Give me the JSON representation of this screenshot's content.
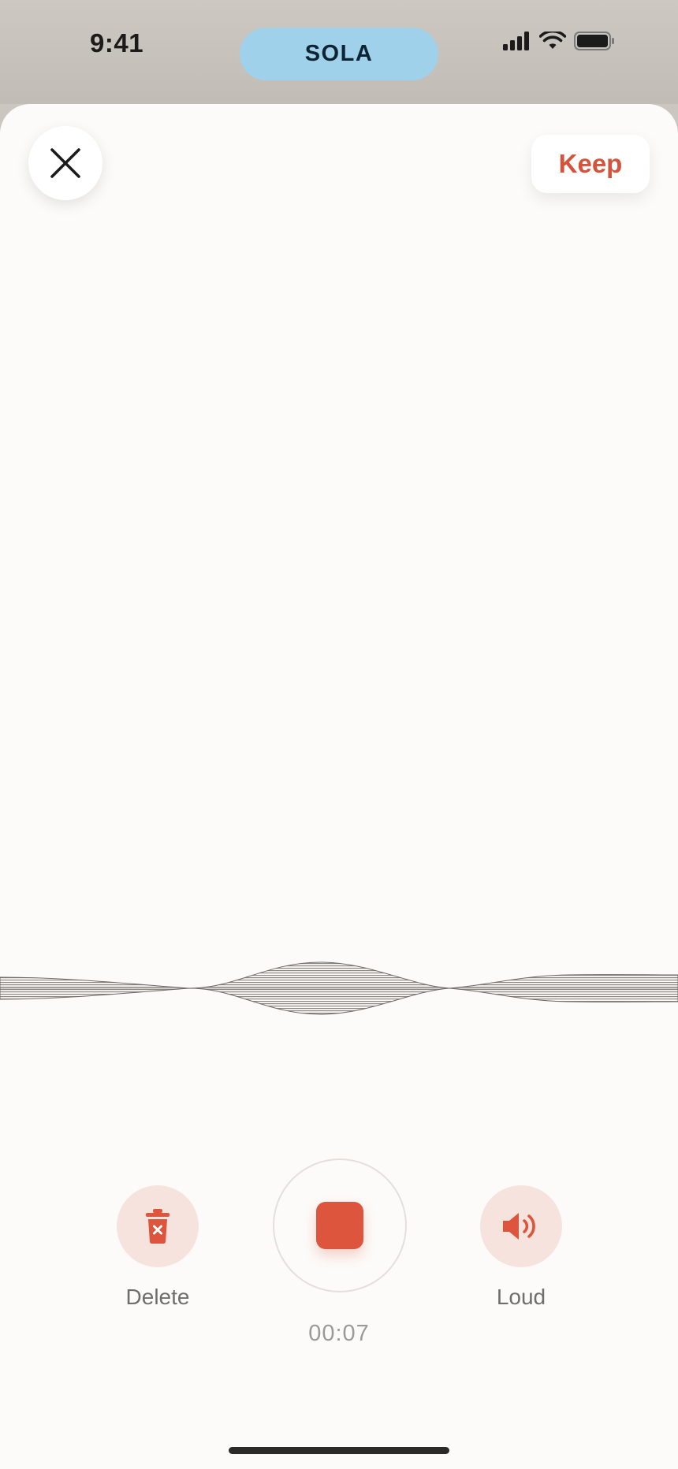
{
  "status_bar": {
    "time": "9:41",
    "island_label": "SOLA",
    "icons": [
      "signal-icon",
      "wifi-icon",
      "battery-icon"
    ]
  },
  "header": {
    "close_icon": "close-icon",
    "keep_label": "Keep"
  },
  "recorder": {
    "waveform_icon": "waveform",
    "delete_label": "Delete",
    "delete_icon": "trash-icon",
    "stop_icon": "stop-icon",
    "loud_label": "Loud",
    "loud_icon": "speaker-icon",
    "elapsed": "00:07"
  },
  "colors": {
    "accent": "#dc553c",
    "accent_soft": "#f7e3dd",
    "island": "#9fd1ea",
    "sheet": "#fcfbf9"
  }
}
